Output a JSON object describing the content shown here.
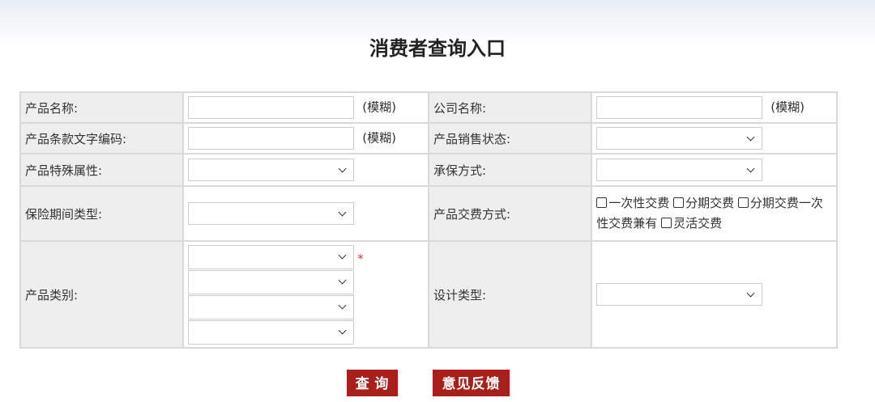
{
  "title": "消费者查询入口",
  "fuzzy": "(模糊)",
  "labels": {
    "product_name": "产品名称:",
    "company_name": "公司名称:",
    "clause_code": "产品条款文字编码:",
    "sale_status": "产品销售状态:",
    "special_attr": "产品特殊属性:",
    "underwriting": "承保方式:",
    "period_type": "保险期间类型:",
    "payment": "产品交费方式:",
    "category": "产品类别:",
    "design": "设计类型:"
  },
  "payment_options": [
    "一次性交费",
    "分期交费",
    "分期交费一次性交费兼有",
    "灵活交费"
  ],
  "required_mark": "*",
  "buttons": {
    "search": "查 询",
    "feedback": "意见反馈"
  }
}
